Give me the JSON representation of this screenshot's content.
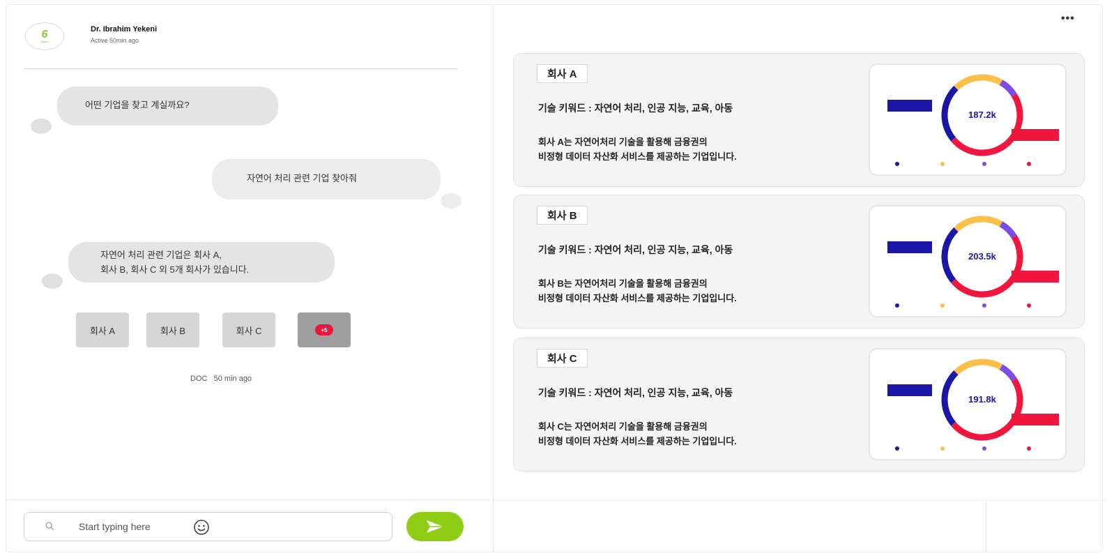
{
  "header": {
    "user_name": "Dr. Ibrahim Yekeni",
    "user_status": "Active 50min ago",
    "avatar_letter": "6",
    "avatar_caption": "Baltrie"
  },
  "chat": {
    "messages": [
      {
        "from": "bot",
        "text": "어떤 기업을 찾고 계실까요?"
      },
      {
        "from": "user",
        "text": "자연어 처리 관련 기업 찾아줘"
      },
      {
        "from": "bot",
        "line1": "자연어 처리 관련 기업은 회사 A,",
        "line2": "회사 B, 회사 C 외 5개 회사가 있습니다."
      }
    ],
    "chips": [
      "회사 A",
      "회사 B",
      "회사 C"
    ],
    "more_badge": "+5",
    "meta_sender": "DOC",
    "meta_time": "50 min ago"
  },
  "composer": {
    "placeholder": "Start typing here",
    "search_icon": "search-icon",
    "emoji_icon": "smiley-icon",
    "send_icon": "paper-plane-icon"
  },
  "colors": {
    "accent_green": "#8fcd14",
    "series_navy": "#1a17a8",
    "series_yellow": "#fcbf49",
    "series_purple": "#7b4ce6",
    "series_red": "#f0163d"
  },
  "companies": [
    {
      "title": "회사 A",
      "keywords": "기술 키워드 : 자연어 처리, 인공 지능, 교육, 아동",
      "desc_line1": "회사 A는 자연어처리 기술을 활용해 금융권의",
      "desc_line2": "비정형 데이터 자산화 서비스를 제공하는 기업입니다.",
      "chart_value": "187.2k"
    },
    {
      "title": "회사 B",
      "keywords": "기술 키워드 : 자연어 처리, 인공 지능, 교육, 아동",
      "desc_line1": "회사 B는 자연어처리 기술을 활용해 금융권의",
      "desc_line2": "비정형 데이터 자산화 서비스를 제공하는 기업입니다.",
      "chart_value": "203.5k"
    },
    {
      "title": "회사 C",
      "keywords": "기술 키워드 : 자연어 처리, 인공 지능, 교육, 아동",
      "desc_line1": "회사 C는 자연어처리 기술을 활용해 금융권의",
      "desc_line2": "비정형 데이터 자산화 서비스를 제공하는 기업입니다.",
      "chart_value": "191.8k"
    }
  ]
}
